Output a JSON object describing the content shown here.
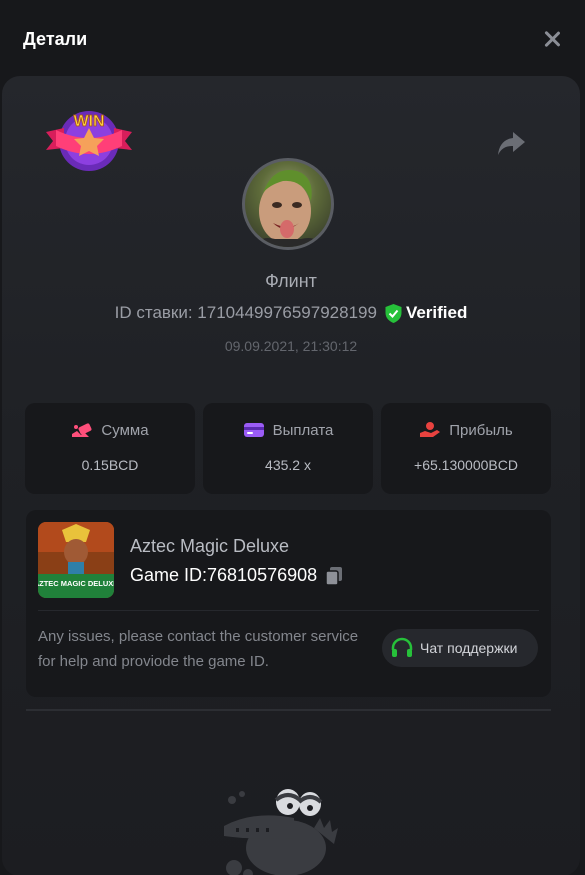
{
  "header": {
    "title": "Детали"
  },
  "bet": {
    "username": "Флинт",
    "id_label": "ID ставки: 1710449976597928199",
    "verified_label": "Verified",
    "datetime": "09.09.2021, 21:30:12",
    "badge_text": "WIN"
  },
  "stats": [
    {
      "label": "Сумма",
      "value": "0.15BCD",
      "icon": "coins-icon",
      "icon_color": "#ff4f7b"
    },
    {
      "label": "Выплата",
      "value": "435.2 x",
      "icon": "card-icon",
      "icon_color": "#9b5cf6"
    },
    {
      "label": "Прибыль",
      "value": "+65.130000BCD",
      "icon": "hand-coin-icon",
      "icon_color": "#e8423f"
    }
  ],
  "game": {
    "name": "Aztec Magic Deluxe",
    "id_label": "Game ID:76810576908",
    "thumb_text": "AZTEC MAGIC DELUXE",
    "issue_text": "Any issues, please contact the customer service for help and proviode the game ID.",
    "support_label": "Чат поддержки"
  },
  "colors": {
    "accent_green": "#26c13a",
    "background": "#17181b",
    "card": "#222428"
  }
}
